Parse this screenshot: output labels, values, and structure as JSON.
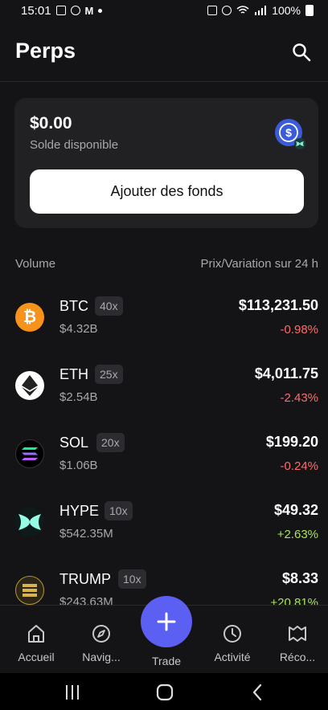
{
  "status_bar": {
    "time": "15:01",
    "battery": "100%"
  },
  "header": {
    "title": "Perps"
  },
  "balance_card": {
    "amount": "$0.00",
    "label": "Solde disponible",
    "add_funds_label": "Ajouter des fonds"
  },
  "list_header": {
    "left": "Volume",
    "right": "Prix/Variation sur 24 h"
  },
  "markets": [
    {
      "symbol": "BTC",
      "leverage": "40x",
      "volume": "$4.32B",
      "price": "$113,231.50",
      "change": "-0.98%",
      "direction": "down",
      "icon": "bitcoin-icon"
    },
    {
      "symbol": "ETH",
      "leverage": "25x",
      "volume": "$2.54B",
      "price": "$4,011.75",
      "change": "-2.43%",
      "direction": "down",
      "icon": "ethereum-icon"
    },
    {
      "symbol": "SOL",
      "leverage": "20x",
      "volume": "$1.06B",
      "price": "$199.20",
      "change": "-0.24%",
      "direction": "down",
      "icon": "solana-icon"
    },
    {
      "symbol": "HYPE",
      "leverage": "10x",
      "volume": "$542.35M",
      "price": "$49.32",
      "change": "+2.63%",
      "direction": "up",
      "icon": "hype-icon"
    },
    {
      "symbol": "TRUMP",
      "leverage": "10x",
      "volume": "$243.63M",
      "price": "$8.33",
      "change": "+20.81%",
      "direction": "up",
      "icon": "trump-icon"
    }
  ],
  "bottom_nav": {
    "home": "Accueil",
    "browse": "Navig...",
    "trade": "Trade",
    "activity": "Activité",
    "rewards": "Réco..."
  },
  "colors": {
    "accent": "#5b5ff2",
    "negative": "#ff6b6b",
    "positive": "#a6e35a",
    "background": "#141416",
    "card": "#212124"
  }
}
